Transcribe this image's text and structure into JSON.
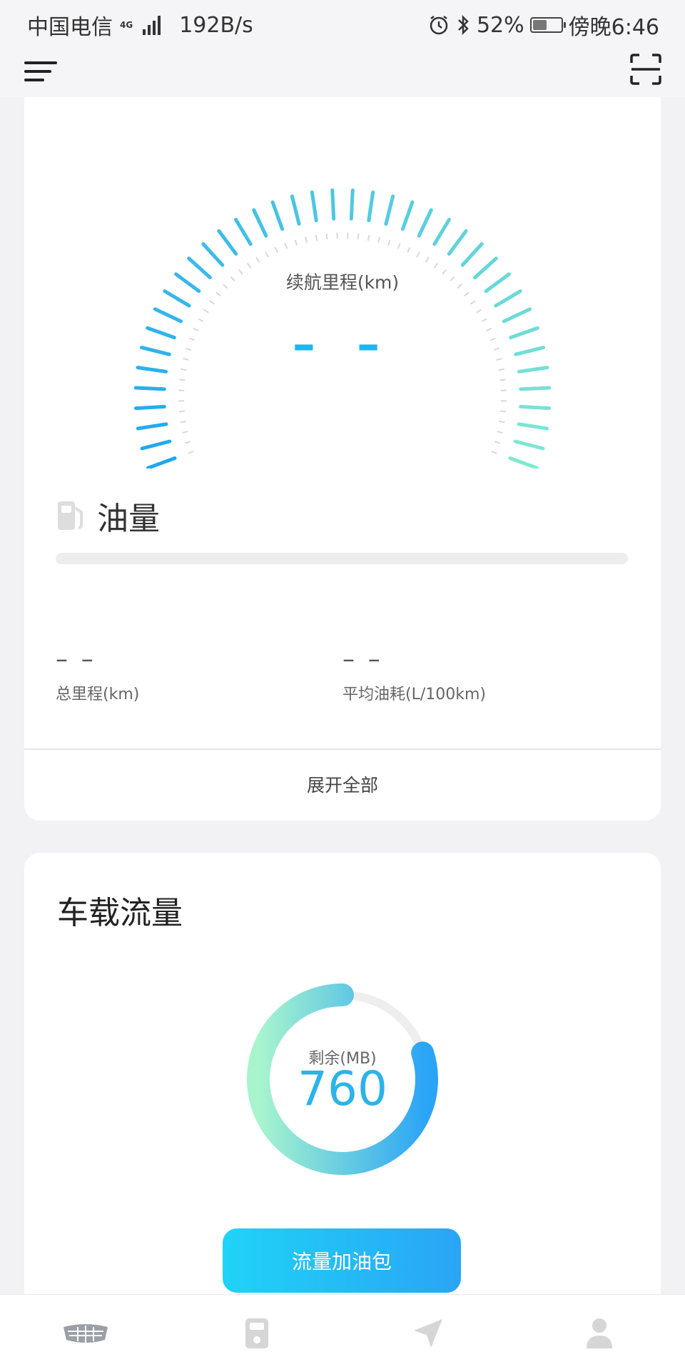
{
  "status_bar": {
    "carrier": "中国电信",
    "network": "4G",
    "speed": "192B/s",
    "battery": "52%",
    "time": "傍晚6:46",
    "battery_level": 0.52
  },
  "icons": {
    "menu": "menu-icon",
    "scan": "scan-icon",
    "fuel": "fuel-pump-icon",
    "alarm": "alarm-icon",
    "bluetooth": "bluetooth-icon"
  },
  "gauge": {
    "label": "续航里程(km)",
    "value": "– –",
    "colors": {
      "start": "#1ea8f0",
      "end": "#7fe8d2"
    }
  },
  "fuel": {
    "title": "油量",
    "level": 0
  },
  "stats": [
    {
      "value": "– –",
      "label": "总里程(km)"
    },
    {
      "value": "– –",
      "label": "平均油耗(L/100km)"
    }
  ],
  "expand_label": "展开全部",
  "data_card": {
    "title": "车载流量",
    "remaining_label": "剩余(MB)",
    "remaining_value": "760",
    "ring_fill": 0.8,
    "button_label": "流量加油包",
    "colors": {
      "top": "#2aa4f5",
      "bottom": "#a8f5cd",
      "track": "#eeeeee"
    }
  },
  "bottom_nav": [
    {
      "name": "car-brand-icon"
    },
    {
      "name": "fuel-station-icon"
    },
    {
      "name": "navigation-icon"
    },
    {
      "name": "profile-icon"
    }
  ]
}
